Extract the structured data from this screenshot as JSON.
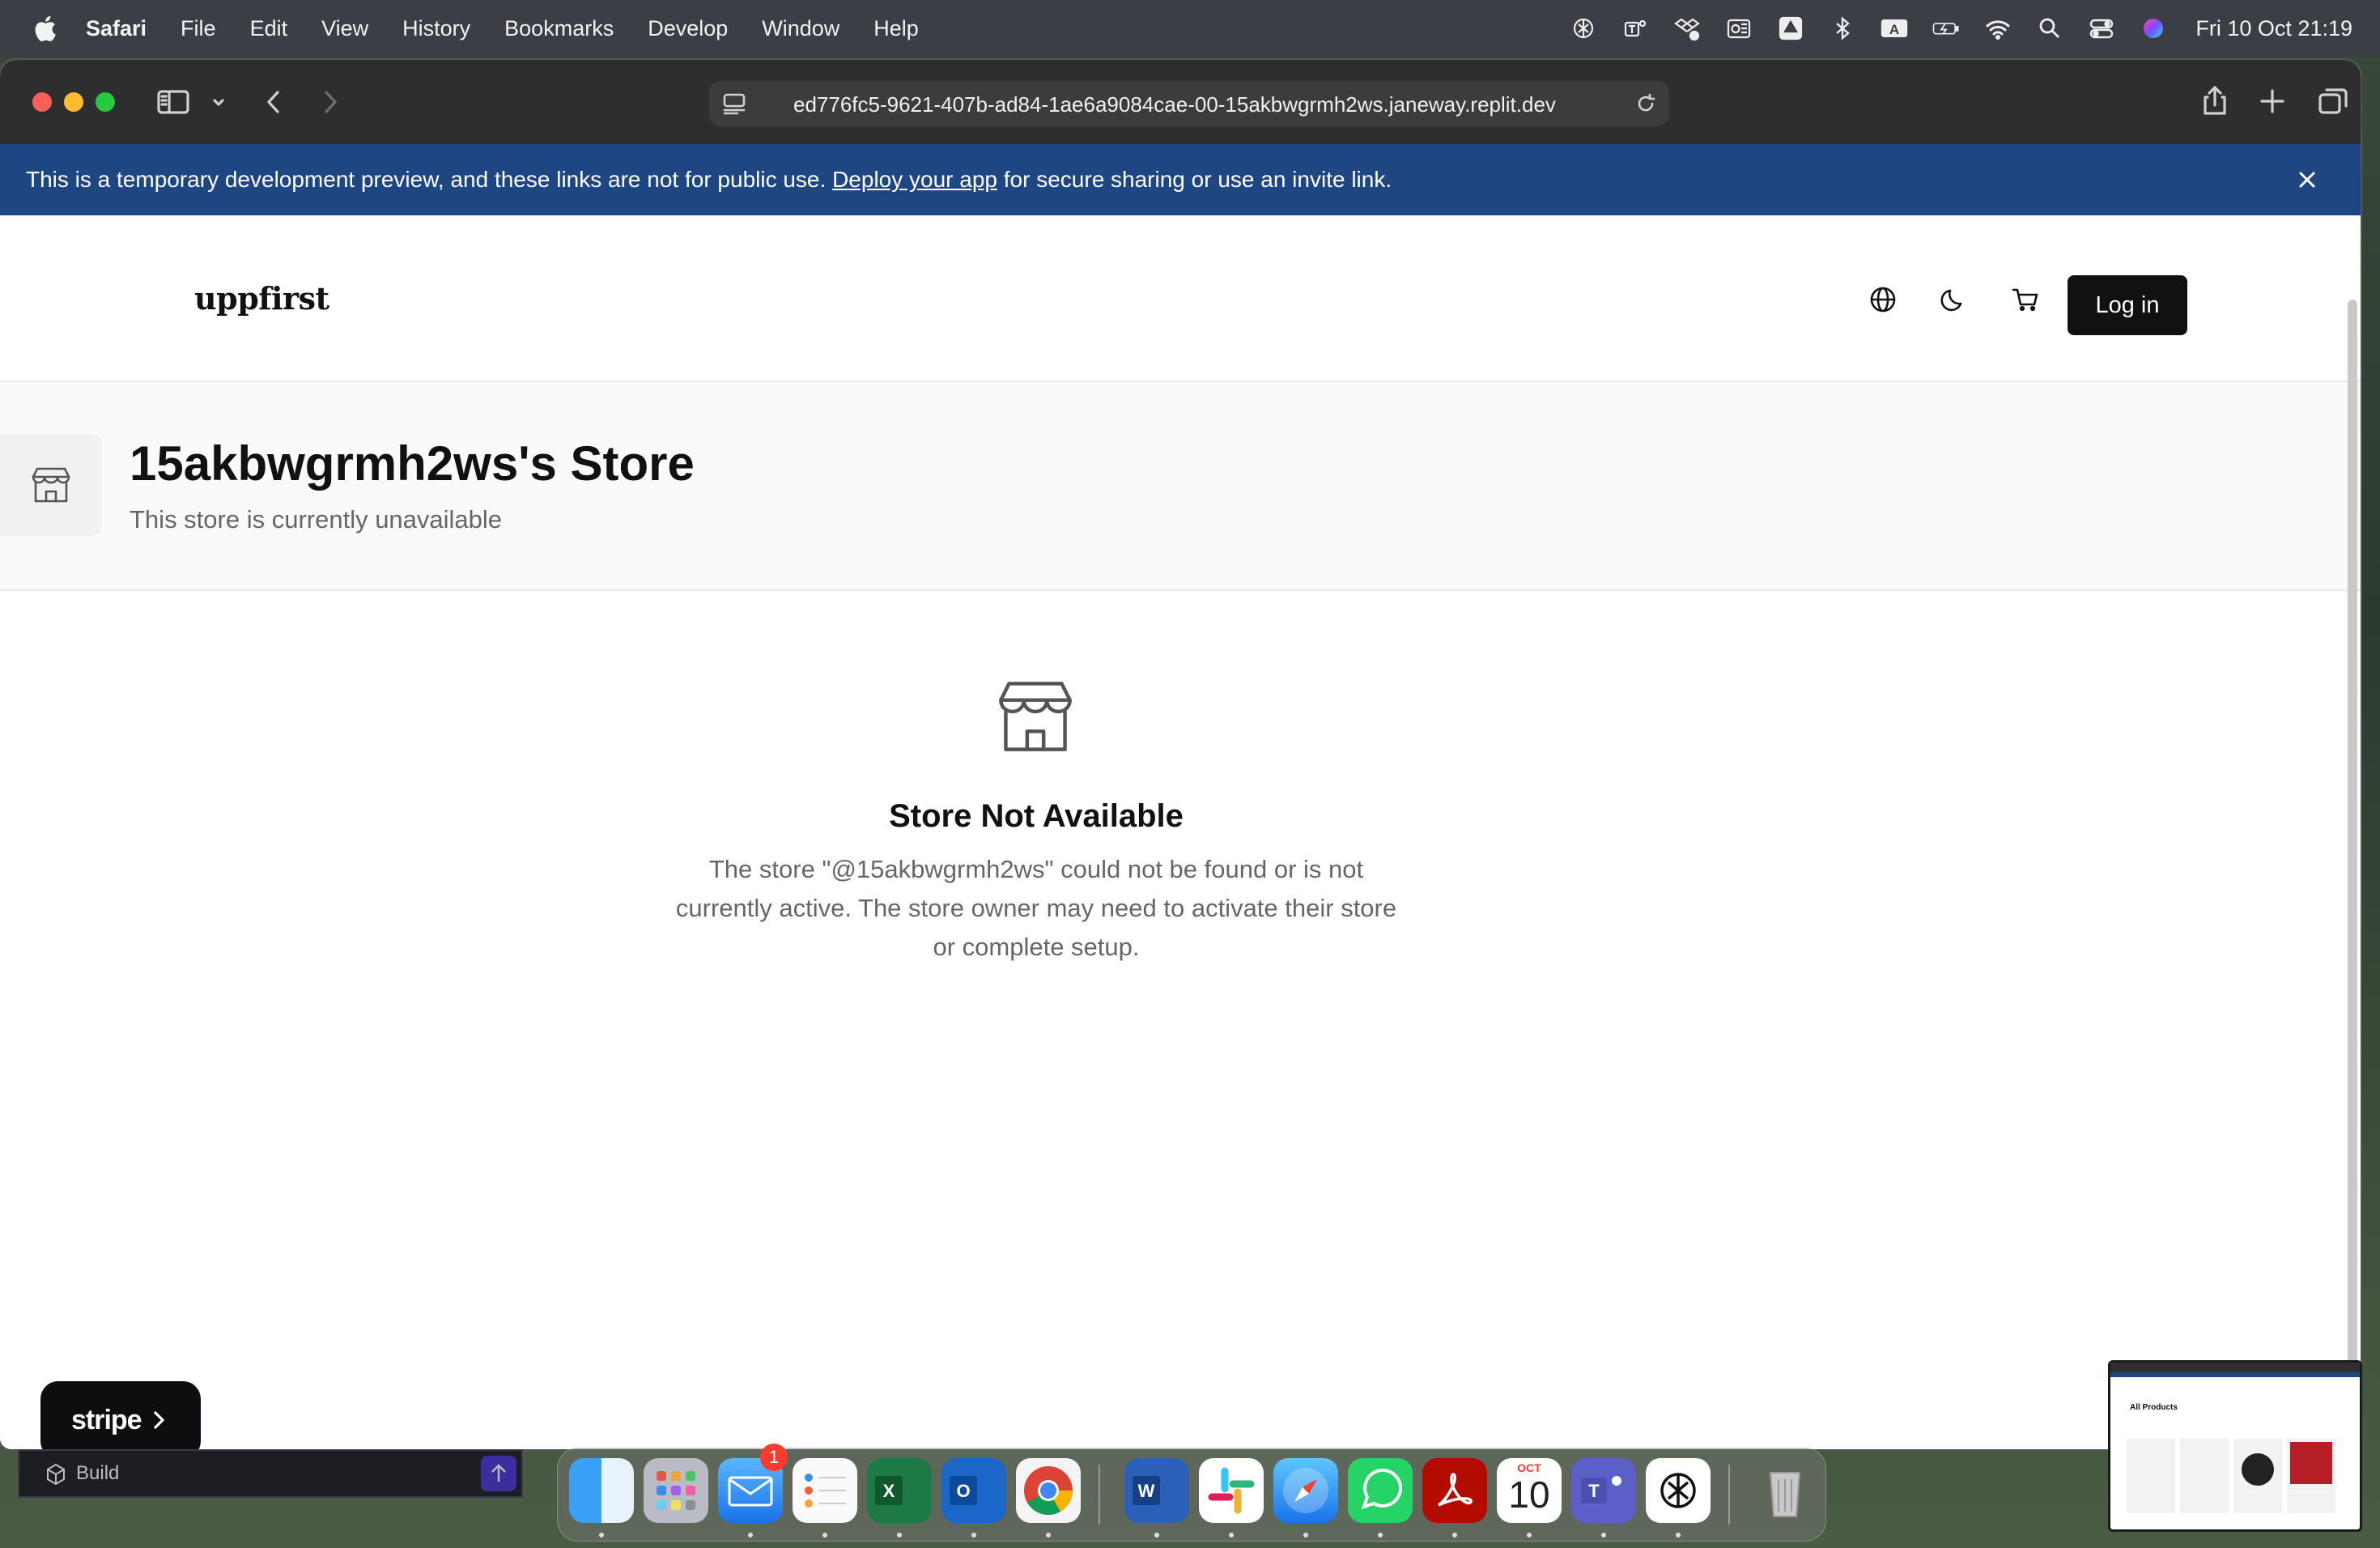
{
  "menubar": {
    "app_name": "Safari",
    "menus": [
      "File",
      "Edit",
      "View",
      "History",
      "Bookmarks",
      "Develop",
      "Window",
      "Help"
    ],
    "status_icons": [
      "chatgpt-icon",
      "teams-icon",
      "dropbox-icon",
      "outlook-icon",
      "drive-icon",
      "bluetooth-icon",
      "input-source-icon",
      "battery-icon",
      "wifi-icon",
      "spotlight-icon",
      "control-center-icon",
      "siri-icon"
    ],
    "input_source": "A",
    "clock": "Fri 10 Oct  21:19"
  },
  "browser": {
    "url": "ed776fc5-9621-407b-ad84-1ae6a9084cae-00-15akbwgrmh2ws.janeway.replit.dev"
  },
  "banner": {
    "text_before": "This is a temporary development preview, and these links are not for public use. ",
    "link_text": "Deploy your app",
    "text_after": " for secure sharing or use an invite link."
  },
  "site": {
    "logo": "uppfirst",
    "login_label": "Log in",
    "header_icons": [
      "globe-icon",
      "moon-icon",
      "cart-icon"
    ]
  },
  "store": {
    "name": "15akbwgrmh2ws's Store",
    "subtitle": "This store is currently unavailable",
    "empty_title": "Store Not Available",
    "empty_message": "The store \"@15akbwgrmh2ws\" could not be found or is not currently active. The store owner may need to activate their store or complete setup."
  },
  "stripe_badge": {
    "label": "stripe"
  },
  "workspace": {
    "build_label": "Build"
  },
  "dock": {
    "mail_badge": "1",
    "calendar_month": "OCT",
    "calendar_day": "10",
    "apps": [
      "finder",
      "launchpad",
      "mail",
      "reminders",
      "excel",
      "outlook",
      "chrome",
      "word",
      "slack",
      "safari",
      "whatsapp",
      "acrobat",
      "calendar",
      "teams",
      "chatgpt",
      "trash"
    ]
  },
  "preview": {
    "title": "All Products"
  },
  "colors": {
    "banner": "#1d4683",
    "login_button": "#111111",
    "menubar": "#3b3f45"
  }
}
